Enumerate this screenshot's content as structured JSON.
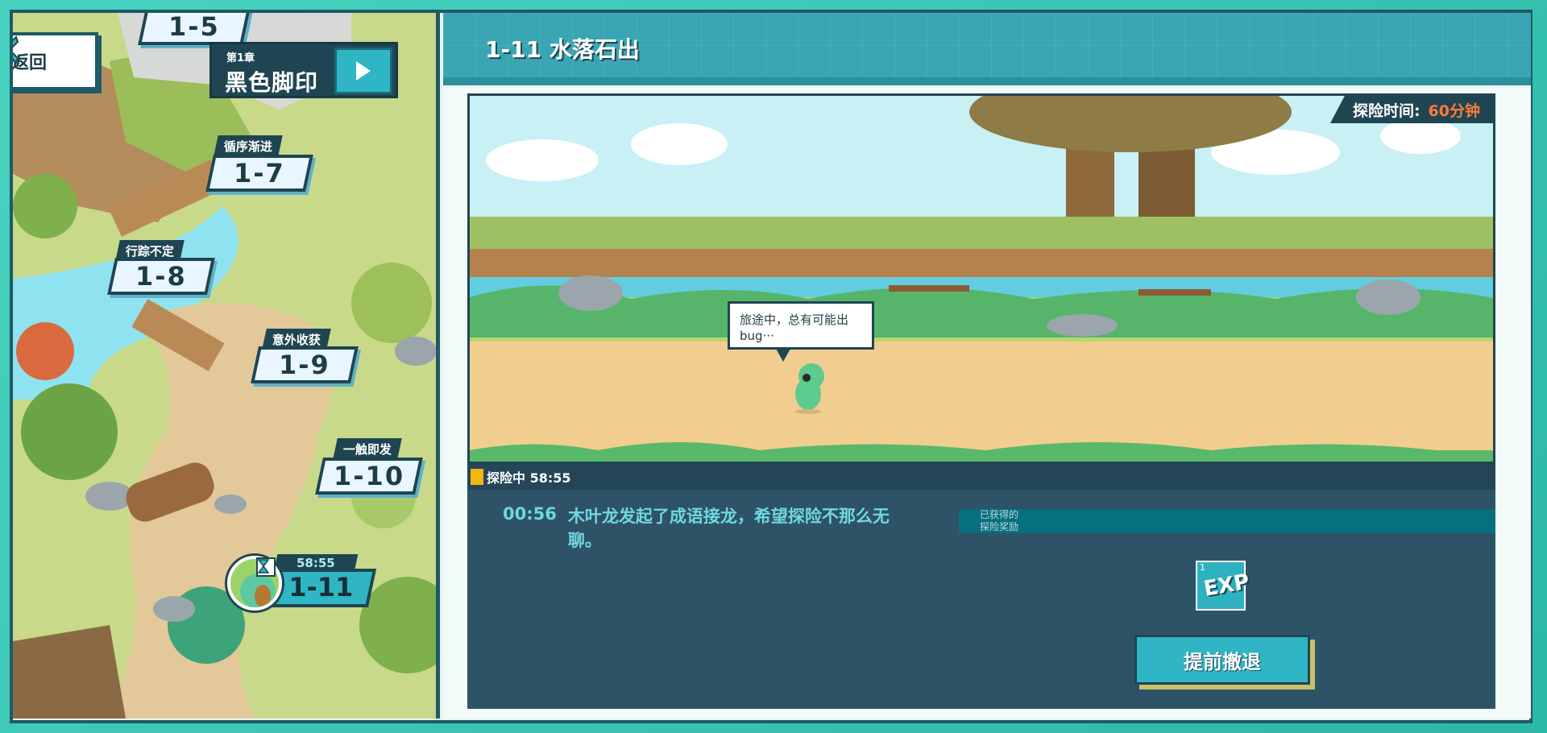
{
  "map": {
    "back_label": "返回",
    "chapter": {
      "number": "第1章",
      "name": "黑色脚印"
    },
    "nodes": [
      {
        "id": "1-5",
        "tag": ""
      },
      {
        "id": "1-7",
        "tag": "循序渐进"
      },
      {
        "id": "1-8",
        "tag": "行踪不定"
      },
      {
        "id": "1-9",
        "tag": "意外收获"
      },
      {
        "id": "1-10",
        "tag": "一触即发"
      }
    ],
    "current_node": {
      "id": "1-11",
      "timer": "58:55"
    }
  },
  "panel": {
    "title": "1-11 水落石出",
    "adventure_time_label": "探险时间:",
    "adventure_time_value": "60分钟",
    "speech_bubble": "旅途中，总有可能出bug···",
    "status": "探险中 58:55",
    "log_entries": [
      {
        "time": "00:56",
        "message": "木叶龙发起了成语接龙，希望探险不那么无聊。"
      }
    ],
    "rewards_header": [
      "已获得的",
      "探险奖励"
    ],
    "reward": {
      "count": "1",
      "label": "EXP"
    },
    "retreat_label": "提前撤退"
  },
  "colors": {
    "frame": "#2bbfae",
    "dark_navy": "#1f4552",
    "accent_teal": "#2fb5c4",
    "time_highlight": "#ff7a3a",
    "status_square": "#f5b512",
    "log_text": "#6fd7e0"
  },
  "icons": {
    "back": "chevron-left-icon",
    "play": "play-icon",
    "hourglass": "hourglass-icon",
    "exp": "exp-card-icon"
  }
}
